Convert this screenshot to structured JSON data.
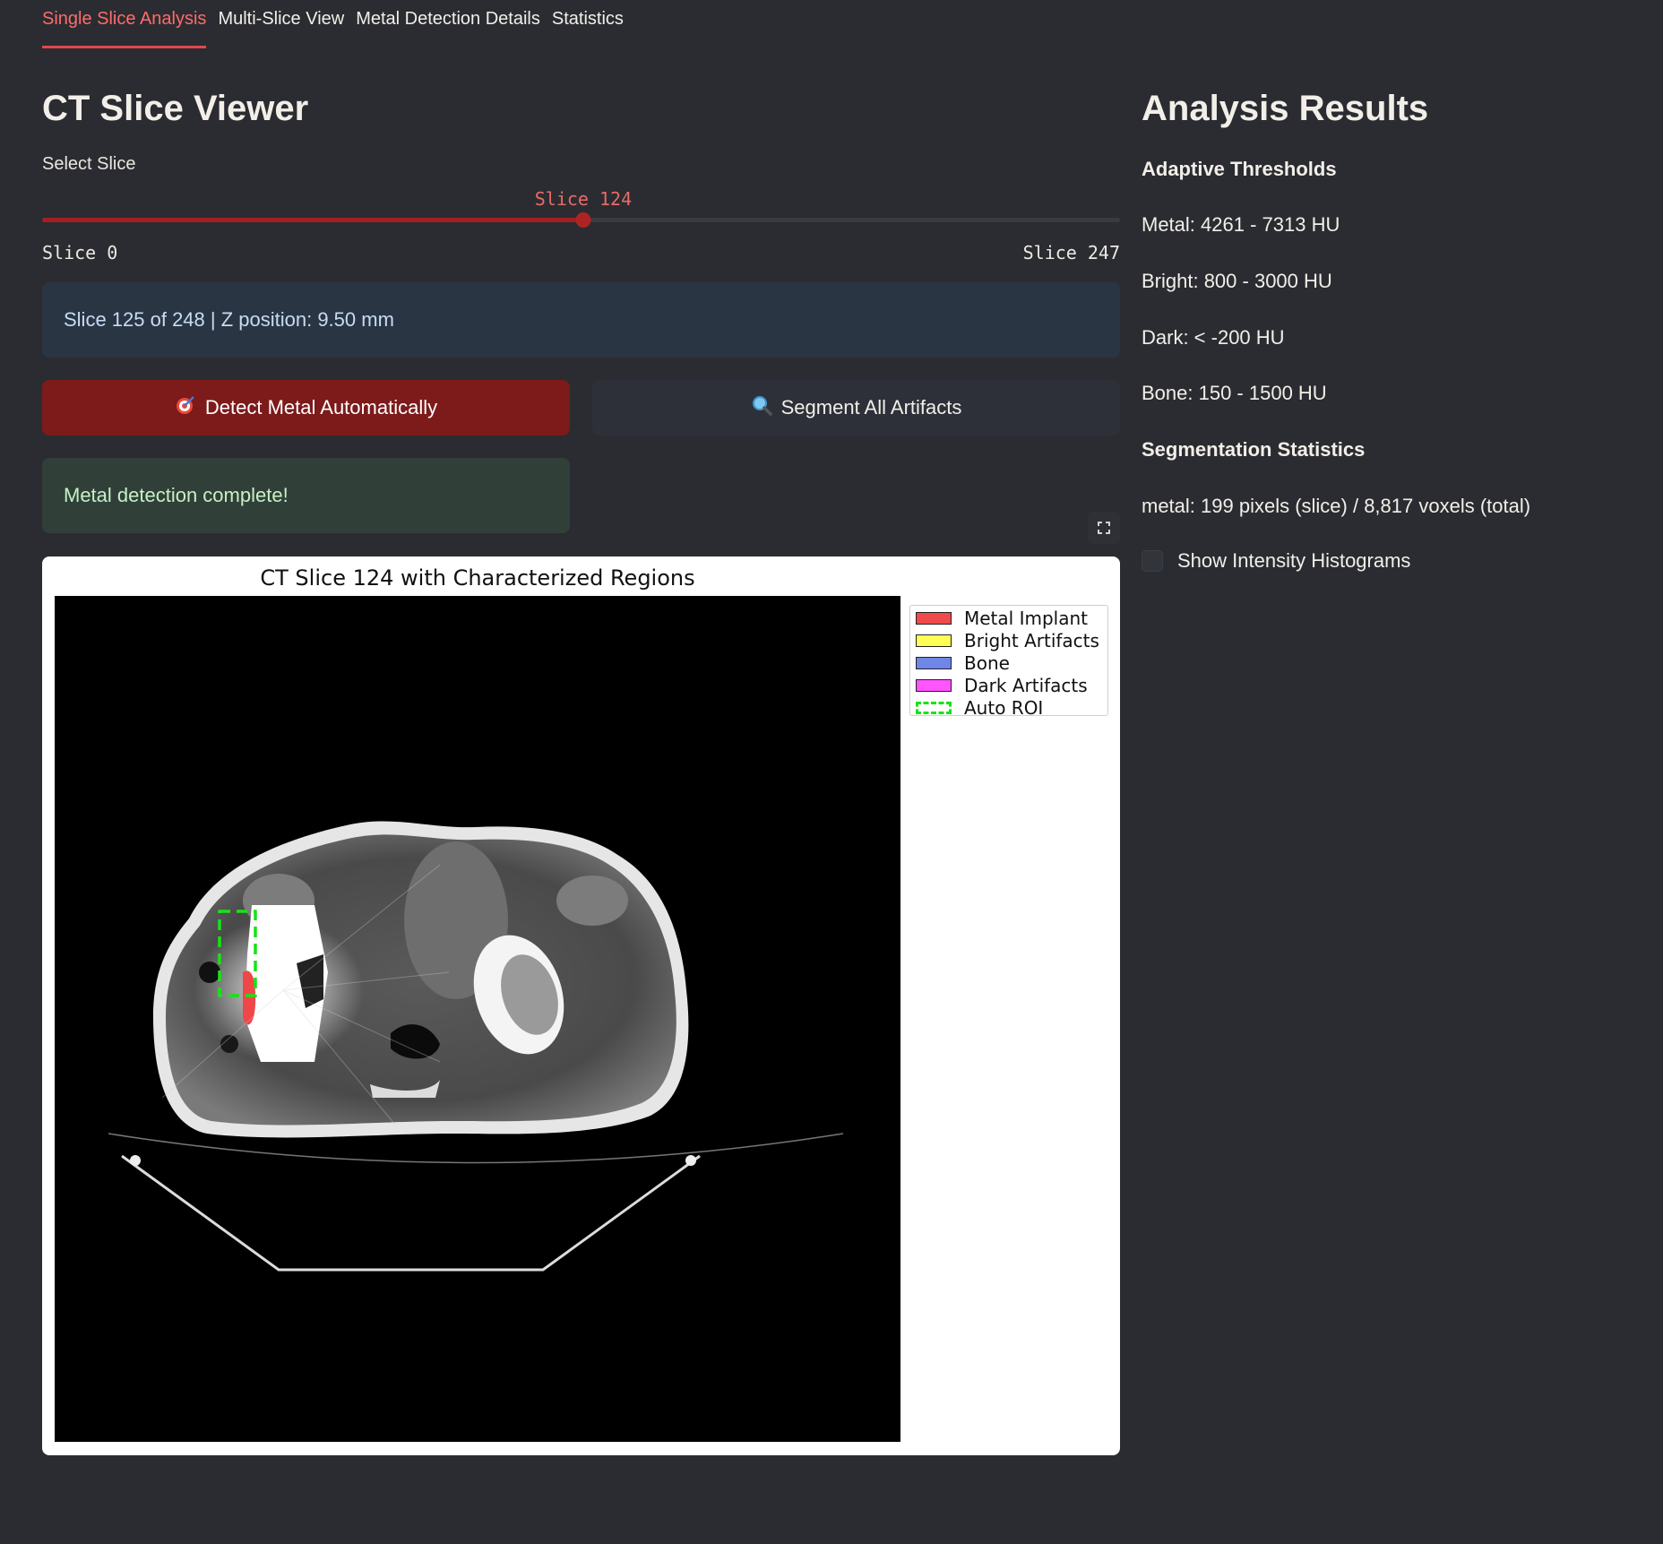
{
  "tabs": [
    "Single Slice Analysis",
    "Multi-Slice View",
    "Metal Detection Details",
    "Statistics"
  ],
  "viewer": {
    "title": "CT Slice Viewer",
    "slider_label": "Select Slice",
    "slider_value_text": "Slice 124",
    "slider_min_text": "Slice 0",
    "slider_max_text": "Slice 247",
    "slider_value": 124,
    "slider_min": 0,
    "slider_max": 247,
    "slice_info": "Slice 125 of 248 | Z position: 9.50 mm",
    "detect_button": "Detect Metal Automatically",
    "detect_icon": "target-icon",
    "segment_button": "Segment All Artifacts",
    "segment_icon": "magnifier-icon",
    "success_message": "Metal detection complete!"
  },
  "figure": {
    "title": "CT Slice 124 with Characterized Regions",
    "legend": [
      {
        "label": "Metal Implant",
        "color": "#f04b4b"
      },
      {
        "label": "Bright Artifacts",
        "color": "#ffff55"
      },
      {
        "label": "Bone",
        "color": "#6f86e6"
      },
      {
        "label": "Dark Artifacts",
        "color": "#ff55ff"
      },
      {
        "label": "Auto ROI",
        "color": "#17e317"
      }
    ]
  },
  "results": {
    "title": "Analysis Results",
    "thresholds_heading": "Adaptive Thresholds",
    "metal": "Metal: 4261 - 7313 HU",
    "bright": "Bright: 800 - 3000 HU",
    "dark": "Dark: < -200 HU",
    "bone": "Bone: 150 - 1500 HU",
    "seg_heading": "Segmentation Statistics",
    "seg_metal": "metal: 199 pixels (slice) / 8,817 voxels (total)",
    "histogram_toggle": "Show Intensity Histograms",
    "histogram_checked": false
  }
}
